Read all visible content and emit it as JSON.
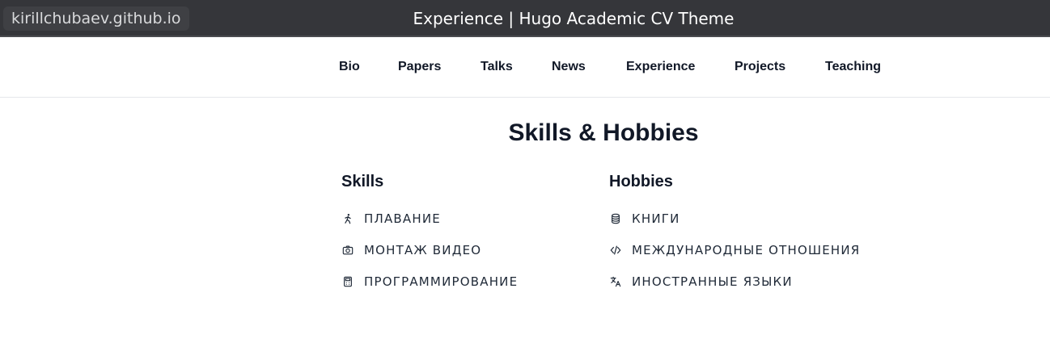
{
  "browser": {
    "url": "kirillchubaev.github.io",
    "title": "Experience | Hugo Academic CV Theme"
  },
  "nav": {
    "items": [
      "Bio",
      "Papers",
      "Talks",
      "News",
      "Experience",
      "Projects",
      "Teaching"
    ]
  },
  "section": {
    "title": "Skills & Hobbies"
  },
  "skills": {
    "heading": "Skills",
    "items": [
      {
        "label": "ПЛАВАНИЕ",
        "icon": "running-person-icon"
      },
      {
        "label": "МОНТАЖ ВИДЕО",
        "icon": "camera-icon"
      },
      {
        "label": "ПРОГРАММИРОВАНИЕ",
        "icon": "calculator-icon"
      }
    ]
  },
  "hobbies": {
    "heading": "Hobbies",
    "items": [
      {
        "label": "КНИГИ",
        "icon": "database-icon"
      },
      {
        "label": "МЕЖДУНАРОДНЫЕ ОТНОШЕНИЯ",
        "icon": "code-icon"
      },
      {
        "label": "ИНОСТРАННЫЕ ЯЗЫКИ",
        "icon": "translate-icon"
      }
    ]
  }
}
